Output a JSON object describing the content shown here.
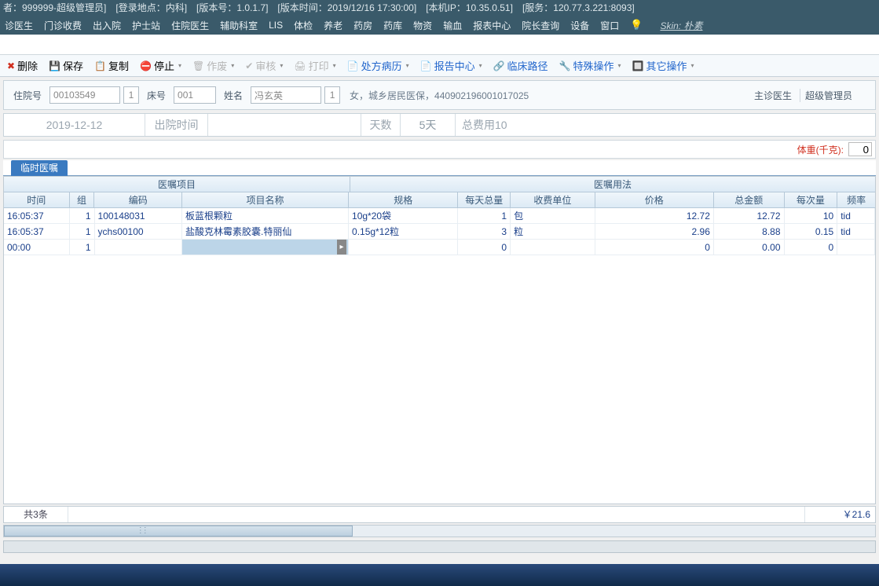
{
  "title_bar": {
    "user": "者：999999-超级管理员]",
    "login_loc": "[登录地点：内科]",
    "version": "[版本号：1.0.1.7]",
    "version_time": "[版本时间：2019/12/16 17:30:00]",
    "local_ip": "[本机IP：10.35.0.51]",
    "service": "[服务：120.77.3.221:8093]"
  },
  "menu": {
    "items": [
      "诊医生",
      "门诊收费",
      "出入院",
      "护士站",
      "住院医生",
      "辅助科室",
      "LIS",
      "体检",
      "养老",
      "药房",
      "药库",
      "物资",
      "输血",
      "报表中心",
      "院长查询",
      "设备",
      "窗口"
    ],
    "skin": "Skin: 朴素"
  },
  "toolbar": {
    "delete": "删除",
    "save": "保存",
    "copy": "复制",
    "stop": "停止",
    "void": "作废",
    "audit": "审核",
    "print": "打印",
    "rx_history": "处方病历",
    "report_center": "报告中心",
    "clinical_path": "临床路径",
    "special_ops": "特殊操作",
    "other_ops": "其它操作"
  },
  "patient_form": {
    "admit_no_label": "住院号",
    "admit_no": "00103549",
    "sel1": "1",
    "bed_label": "床号",
    "bed": "001",
    "name_label": "姓名",
    "name": "冯玄英",
    "sel2": "1",
    "info": "女，城乡居民医保，440902196001017025",
    "doctor_label": "主诊医生",
    "doctor_value": "超级管理员"
  },
  "dates": {
    "admit": "2019-12-12",
    "discharge_label": "出院时间",
    "days_label": "天数",
    "days_value": "5天",
    "fee_label": "总费用10"
  },
  "weight": {
    "label": "体重(千克):",
    "value": "0"
  },
  "tab": {
    "active": "临时医嘱"
  },
  "grid": {
    "group_project": "医嘱项目",
    "group_usage": "医嘱用法",
    "h_time": "时间",
    "h_grp": "组",
    "h_code": "编码",
    "h_name": "项目名称",
    "h_spec": "规格",
    "h_daily": "每天总量",
    "h_unit": "收费单位",
    "h_price": "价格",
    "h_amount": "总金额",
    "h_dose": "每次量",
    "h_freq": "频率",
    "rows": [
      {
        "time": "16:05:37",
        "grp": "1",
        "code": "100148031",
        "name": "板蓝根颗粒",
        "spec": "10g*20袋",
        "daily": "1",
        "unit": "包",
        "price": "12.72",
        "amt": "12.72",
        "dose": "10",
        "freq": "tid"
      },
      {
        "time": "16:05:37",
        "grp": "1",
        "code": "ychs00100",
        "name": "盐酸克林霉素胶囊.特丽仙",
        "spec": "0.15g*12粒",
        "daily": "3",
        "unit": "粒",
        "price": "2.96",
        "amt": "8.88",
        "dose": "0.15",
        "freq": "tid"
      },
      {
        "time": "00:00",
        "grp": "1",
        "code": "",
        "name": "",
        "spec": "",
        "daily": "0",
        "unit": "",
        "price": "0",
        "amt": "0.00",
        "dose": "0",
        "freq": ""
      }
    ]
  },
  "footer": {
    "count": "共3条",
    "total": "￥21.6"
  }
}
